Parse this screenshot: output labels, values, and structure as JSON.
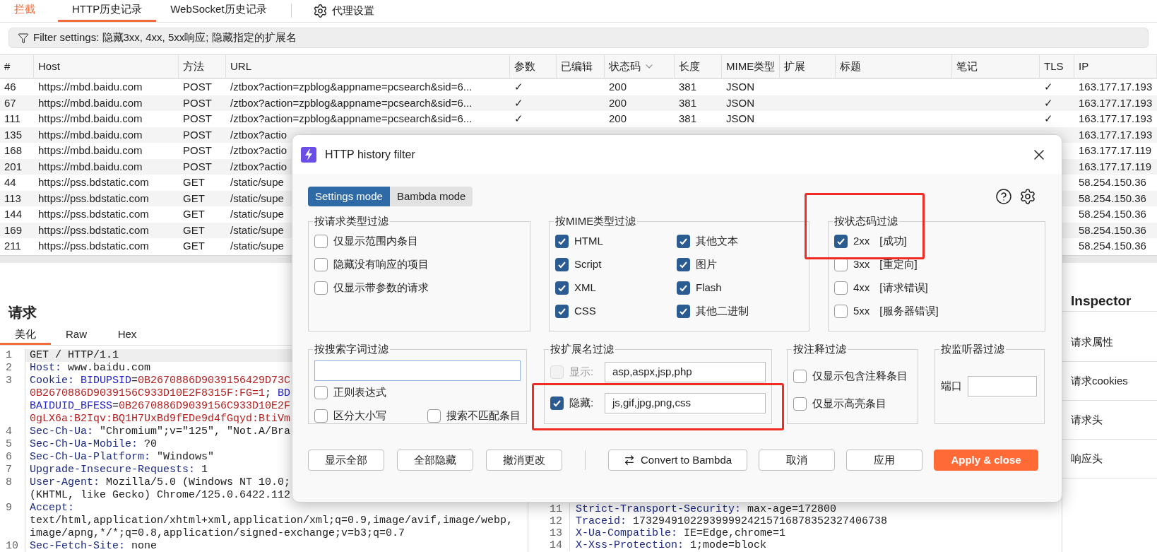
{
  "top_tabs": [
    {
      "label": "拦截",
      "selected": false,
      "alert": true
    },
    {
      "label": "HTTP历史记录",
      "selected": true,
      "alert": false
    },
    {
      "label": "WebSocket历史记录",
      "selected": false,
      "alert": false
    }
  ],
  "proxy_settings": {
    "label": "代理设置"
  },
  "filter_bar": {
    "text": "Filter settings: 隐藏3xx, 4xx, 5xx响应; 隐藏指定的扩展名"
  },
  "table": {
    "columns": [
      {
        "label": "#"
      },
      {
        "label": "Host"
      },
      {
        "label": "方法"
      },
      {
        "label": "URL"
      },
      {
        "label": "参数"
      },
      {
        "label": "已编辑"
      },
      {
        "label": "状态码",
        "sorted": true
      },
      {
        "label": "长度"
      },
      {
        "label": "MIME类型"
      },
      {
        "label": "扩展"
      },
      {
        "label": "标题"
      },
      {
        "label": "笔记"
      },
      {
        "label": "TLS"
      },
      {
        "label": "IP"
      }
    ],
    "rows": [
      {
        "cells": [
          "46",
          "https://mbd.baidu.com",
          "POST",
          "/ztbox?action=zpblog&appname=pcsearch&sid=6...",
          "✓",
          "",
          "200",
          "381",
          "JSON",
          "",
          "",
          "",
          "✓",
          "163.177.17.193"
        ]
      },
      {
        "cells": [
          "67",
          "https://mbd.baidu.com",
          "POST",
          "/ztbox?action=zpblog&appname=pcsearch&sid=6...",
          "✓",
          "",
          "200",
          "381",
          "JSON",
          "",
          "",
          "",
          "✓",
          "163.177.17.193"
        ]
      },
      {
        "cells": [
          "111",
          "https://mbd.baidu.com",
          "POST",
          "/ztbox?action=zpblog&appname=pcsearch&sid=6...",
          "✓",
          "",
          "200",
          "381",
          "JSON",
          "",
          "",
          "",
          "✓",
          "163.177.17.193"
        ]
      },
      {
        "cells": [
          "135",
          "https://mbd.baidu.com",
          "POST",
          "/ztbox?actio",
          "",
          "",
          "",
          "",
          "",
          "",
          "",
          "",
          "",
          "163.177.17.193"
        ]
      },
      {
        "cells": [
          "168",
          "https://mbd.baidu.com",
          "POST",
          "/ztbox?actio",
          "",
          "",
          "",
          "",
          "",
          "",
          "",
          "",
          "",
          "163.177.17.119"
        ]
      },
      {
        "cells": [
          "201",
          "https://mbd.baidu.com",
          "POST",
          "/ztbox?actio",
          "",
          "",
          "",
          "",
          "",
          "",
          "",
          "",
          "",
          "163.177.17.119"
        ]
      },
      {
        "cells": [
          "44",
          "https://pss.bdstatic.com",
          "GET",
          "/static/supe",
          "",
          "",
          "",
          "",
          "",
          "",
          "",
          "",
          "",
          "58.254.150.36"
        ]
      },
      {
        "cells": [
          "113",
          "https://pss.bdstatic.com",
          "GET",
          "/static/supe",
          "",
          "",
          "",
          "",
          "",
          "",
          "",
          "",
          "",
          "58.254.150.36"
        ]
      },
      {
        "cells": [
          "144",
          "https://pss.bdstatic.com",
          "GET",
          "/static/supe",
          "",
          "",
          "",
          "",
          "",
          "",
          "",
          "",
          "",
          "58.254.150.36"
        ]
      },
      {
        "cells": [
          "169",
          "https://pss.bdstatic.com",
          "GET",
          "/static/supe",
          "",
          "",
          "",
          "",
          "",
          "",
          "",
          "",
          "",
          "58.254.150.36"
        ]
      },
      {
        "cells": [
          "211",
          "https://pss.bdstatic.com",
          "GET",
          "/static/supe",
          "",
          "",
          "",
          "",
          "",
          "",
          "",
          "",
          "",
          "58.254.150.36"
        ]
      }
    ]
  },
  "request": {
    "title": "请求",
    "tabs": [
      {
        "label": "美化",
        "selected": true
      },
      {
        "label": "Raw",
        "selected": false
      },
      {
        "label": "Hex",
        "selected": false
      }
    ],
    "lines": [
      {
        "num": "1",
        "current": true,
        "parts": [
          {
            "text": "GET / HTTP/1.1",
            "kind": "value"
          }
        ]
      },
      {
        "num": "2",
        "current": false,
        "parts": [
          {
            "text": "Host:",
            "kind": "key"
          },
          {
            "text": " www.baidu.com",
            "kind": "value"
          }
        ]
      },
      {
        "num": "3",
        "current": false,
        "parts": [
          {
            "text": "Cookie: ",
            "kind": "key"
          },
          {
            "text": "BIDUPSID",
            "kind": "cname"
          },
          {
            "text": "=",
            "kind": "value"
          },
          {
            "text": "0B2670886D9039156429D73C",
            "kind": "cval"
          }
        ]
      },
      {
        "current": false,
        "parts": [
          {
            "text": "0B2670886D9039156C933D10E2F8315F:FG=1",
            "kind": "cval"
          },
          {
            "text": "; ",
            "kind": "value"
          },
          {
            "text": "BD",
            "kind": "cname"
          }
        ]
      },
      {
        "current": false,
        "parts": [
          {
            "text": "BAIDUID_BFESS",
            "kind": "cname"
          },
          {
            "text": "=",
            "kind": "value"
          },
          {
            "text": "0B2670886D9039156C933D10E2F",
            "kind": "cval"
          }
        ]
      },
      {
        "current": false,
        "parts": [
          {
            "text": "0gLX6a:B2Iqv:BQ1H7UxBd9fEDe9d4fGqyd:BtiVm",
            "kind": "cval"
          }
        ]
      },
      {
        "num": "4",
        "current": false,
        "parts": [
          {
            "text": "Sec-Ch-Ua:",
            "kind": "key"
          },
          {
            "text": " \"Chromium\";v=\"125\", \"Not.A/Bra",
            "kind": "value"
          }
        ]
      },
      {
        "num": "5",
        "current": false,
        "parts": [
          {
            "text": "Sec-Ch-Ua-Mobile:",
            "kind": "key"
          },
          {
            "text": " ?0",
            "kind": "value"
          }
        ]
      },
      {
        "num": "6",
        "current": false,
        "parts": [
          {
            "text": "Sec-Ch-Ua-Platform:",
            "kind": "key"
          },
          {
            "text": " \"Windows\"",
            "kind": "value"
          }
        ]
      },
      {
        "num": "7",
        "current": false,
        "parts": [
          {
            "text": "Upgrade-Insecure-Requests:",
            "kind": "key"
          },
          {
            "text": " 1",
            "kind": "value"
          }
        ]
      },
      {
        "num": "8",
        "current": false,
        "parts": [
          {
            "text": "User-Agent:",
            "kind": "key"
          },
          {
            "text": " Mozilla/5.0 (Windows NT 10.0;",
            "kind": "value"
          }
        ]
      },
      {
        "current": false,
        "parts": [
          {
            "text": "(KHTML, like Gecko) Chrome/125.0.6422.112",
            "kind": "value"
          }
        ]
      },
      {
        "num": "9",
        "current": false,
        "parts": [
          {
            "text": "Accept:",
            "kind": "key"
          }
        ]
      },
      {
        "current": false,
        "parts": [
          {
            "text": "text/html,application/xhtml+xml,application/xml;q=0.9,image/avif,image/webp,",
            "kind": "value"
          }
        ]
      },
      {
        "current": false,
        "parts": [
          {
            "text": "image/apng,*/*;q=0.8,application/signed-exchange;v=b3;q=0.7",
            "kind": "value"
          }
        ]
      },
      {
        "num": "10",
        "current": false,
        "parts": [
          {
            "text": "Sec-Fetch-Site:",
            "kind": "key"
          },
          {
            "text": " none",
            "kind": "value"
          }
        ]
      }
    ]
  },
  "response": {
    "lines": [
      {
        "num": "11",
        "parts": [
          {
            "text": "Strict-Transport-Security:",
            "kind": "key"
          },
          {
            "text": " max-age=172800",
            "kind": "value"
          }
        ]
      },
      {
        "num": "12",
        "parts": [
          {
            "text": "Traceid:",
            "kind": "key"
          },
          {
            "text": " 1732949102293999924215716878352327406738",
            "kind": "value"
          }
        ]
      },
      {
        "num": "13",
        "parts": [
          {
            "text": "X-Ua-Compatible:",
            "kind": "key"
          },
          {
            "text": " IE=Edge,chrome=1",
            "kind": "value"
          }
        ]
      },
      {
        "num": "14",
        "parts": [
          {
            "text": "X-Xss-Protection:",
            "kind": "key"
          },
          {
            "text": " 1;mode=block",
            "kind": "value"
          }
        ]
      }
    ]
  },
  "inspector": {
    "title": "Inspector",
    "items": [
      "请求属性",
      "请求cookies",
      "请求头",
      "响应头"
    ]
  },
  "dialog": {
    "title": "HTTP history filter",
    "modes": [
      {
        "label": "Settings mode",
        "selected": true
      },
      {
        "label": "Bambda mode",
        "selected": false
      }
    ],
    "groups": [
      {
        "title": "按请求类型过滤",
        "highlighted": false,
        "options": [
          {
            "label": "仅显示范围内条目",
            "checked": false
          },
          {
            "label": "隐藏没有响应的项目",
            "checked": false
          },
          {
            "label": "仅显示带参数的请求",
            "checked": false
          }
        ]
      },
      {
        "title": "按MIME类型过滤",
        "highlighted": false,
        "options": [
          {
            "label": "HTML",
            "checked": true
          },
          {
            "label": "其他文本",
            "checked": true
          },
          {
            "label": "Script",
            "checked": true
          },
          {
            "label": "图片",
            "checked": true
          },
          {
            "label": "XML",
            "checked": true
          },
          {
            "label": "Flash",
            "checked": true
          },
          {
            "label": "CSS",
            "checked": true
          },
          {
            "label": "其他二进制",
            "checked": true
          }
        ]
      },
      {
        "title": "按状态码过滤",
        "highlighted": true,
        "options": [
          {
            "label": "2xx",
            "note": "[成功]",
            "checked": true
          },
          {
            "label": "3xx",
            "note": "[重定向]",
            "checked": false
          },
          {
            "label": "4xx",
            "note": "[请求错误]",
            "checked": false
          },
          {
            "label": "5xx",
            "note": "[服务器错误]",
            "checked": false
          }
        ]
      }
    ],
    "search_group": {
      "title": "按搜索字词过滤",
      "options": [
        {
          "label": "正则表达式",
          "checked": false
        },
        {
          "label": "区分大小写",
          "checked": false
        },
        {
          "label": "搜索不匹配条目",
          "checked": false
        }
      ]
    },
    "extension_group": {
      "title": "按扩展名过滤",
      "rows": [
        {
          "label": "显示:",
          "value": "asp,aspx,jsp,php",
          "checked": false,
          "disabled": true,
          "highlighted": false
        },
        {
          "label": "隐藏:",
          "value": "js,gif,jpg,png,css",
          "checked": true,
          "disabled": false,
          "highlighted": true
        }
      ]
    },
    "comment_group": {
      "title": "按注释过滤",
      "options": [
        {
          "label": "仅显示包含注释条目",
          "checked": false
        },
        {
          "label": "仅显示高亮条目",
          "checked": false
        }
      ]
    },
    "listener_group": {
      "title": "按监听器过滤",
      "port_label": "端口"
    },
    "left_buttons": [
      {
        "label": "显示全部"
      },
      {
        "label": "全部隐藏"
      },
      {
        "label": "撤消更改"
      }
    ],
    "right_buttons": [
      {
        "label": "Convert to Bambda",
        "kind": "convert"
      },
      {
        "label": "取消",
        "kind": "plain"
      },
      {
        "label": "应用",
        "kind": "plain"
      },
      {
        "label": "Apply & close",
        "kind": "primary"
      }
    ]
  }
}
